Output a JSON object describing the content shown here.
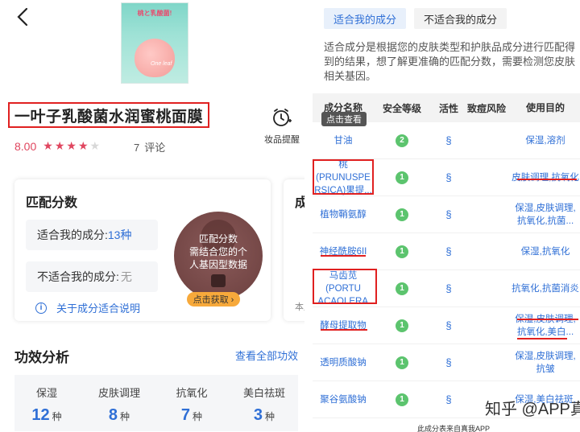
{
  "left": {
    "product_image_text": "桃と乳酸菌!",
    "product_brand": "One leaf",
    "product_title": "一叶子乳酸菌水润蜜桃面膜",
    "reminder_label": "妆品提醒",
    "rating_score": "8.00",
    "rating_stars": [
      true,
      true,
      true,
      true,
      false
    ],
    "reviews_count": "7",
    "reviews_label": "评论",
    "match_card": {
      "title": "匹配分数",
      "suitable_label": "适合我的成分: ",
      "suitable_value": "13种",
      "unsuitable_label": "不适合我的成分: ",
      "unsuitable_value": "无",
      "about_link": "关于成分适合说明",
      "circle_lines": [
        "匹配分数",
        "需结合您的个",
        "人基因型数据"
      ],
      "get_button": "点击获取 ›"
    },
    "second_card": {
      "title": "成",
      "bottom": "本产"
    },
    "efficacy": {
      "title": "功效分析",
      "view_all": "查看全部功效",
      "items": [
        {
          "name": "保湿",
          "count": "12",
          "unit": "种"
        },
        {
          "name": "皮肤调理",
          "count": "8",
          "unit": "种"
        },
        {
          "name": "抗氧化",
          "count": "7",
          "unit": "种"
        },
        {
          "name": "美白祛斑",
          "count": "3",
          "unit": "种"
        }
      ]
    }
  },
  "right": {
    "tabs": [
      "适合我的成分",
      "不适合我的成分"
    ],
    "description": "适合成分是根据您的皮肤类型和护肤品成分进行匹配得到的结果，想了解更准确的匹配分数，需要检测您皮肤相关基因。",
    "table_headers": [
      "成分名称",
      "安全等级",
      "活性",
      "致痘风险",
      "使用目的"
    ],
    "tooltip": "点击查看",
    "rows": [
      {
        "name": "甘油",
        "safety": "2",
        "active": true,
        "purpose": "保湿,溶剂"
      },
      {
        "name": "桃(PRUNUSPE RSICA)果提...",
        "safety": "1",
        "active": true,
        "purpose": "皮肤调理,抗氧化"
      },
      {
        "name": "植物鞘氨醇",
        "safety": "1",
        "active": true,
        "purpose": "保湿,皮肤调理,抗氧化,抗菌..."
      },
      {
        "name": "神经酰胺6II",
        "safety": "1",
        "active": true,
        "purpose": "保湿,抗氧化"
      },
      {
        "name": "马齿苋(PORTU LACAOLERA...",
        "safety": "1",
        "active": true,
        "purpose": "抗氧化,抗菌消炎"
      },
      {
        "name": "酵母提取物",
        "safety": "1",
        "active": true,
        "purpose": "保湿,皮肤调理,抗氧化,美白..."
      },
      {
        "name": "透明质酸钠",
        "safety": "1",
        "active": true,
        "purpose": "保湿,皮肤调理,抗皱"
      },
      {
        "name": "聚谷氨酸钠",
        "safety": "1",
        "active": true,
        "purpose": "保湿,美白祛斑,"
      }
    ],
    "footnote": "此成分表来自真我APP",
    "watermark": "知乎 @APP真我"
  },
  "colors": {
    "accent": "#2f6fd6",
    "highlight_red": "#e02020",
    "star": "#e0465f",
    "safe_green": "#5cc46e",
    "button_orange": "#f7a93b"
  }
}
